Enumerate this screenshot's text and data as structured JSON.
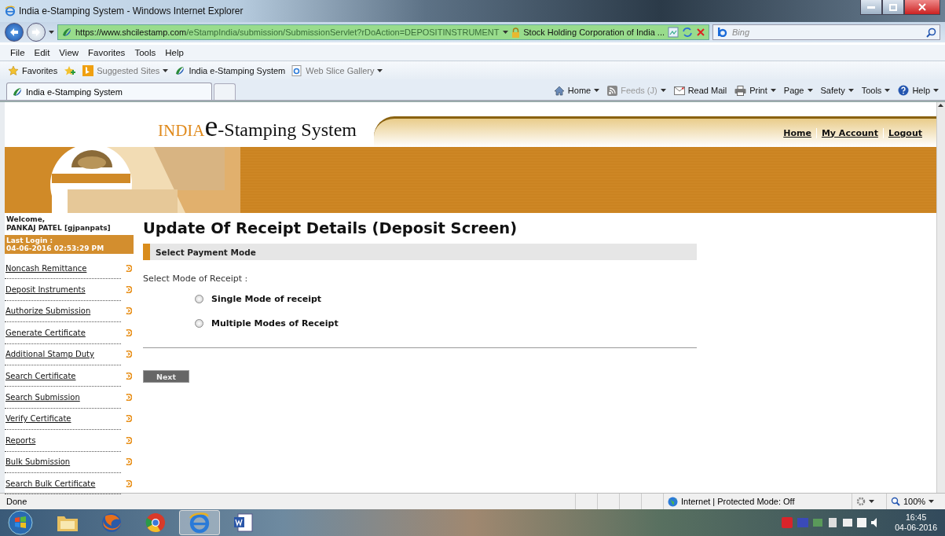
{
  "window": {
    "title": "India e-Stamping System - Windows Internet Explorer"
  },
  "address_bar": {
    "url_host": "https://www.shcilestamp.com",
    "url_path": "/eStampIndia/submission/SubmissionServlet?rDoAction=DEPOSITINSTRUMENT",
    "site_identity": "Stock Holding Corporation of India ...",
    "search_placeholder": "Bing"
  },
  "menu": [
    "File",
    "Edit",
    "View",
    "Favorites",
    "Tools",
    "Help"
  ],
  "favorites_bar": [
    {
      "label": "Favorites",
      "disabled": false,
      "dropdown": false
    },
    {
      "label": "Suggested Sites",
      "disabled": true,
      "dropdown": true
    },
    {
      "label": "India e-Stamping System",
      "disabled": false,
      "dropdown": false
    },
    {
      "label": "Web Slice Gallery",
      "disabled": true,
      "dropdown": true
    }
  ],
  "tabs": [
    {
      "label": "India e-Stamping System",
      "selected": true
    }
  ],
  "command_bar": [
    {
      "label": "Home",
      "disabled": false,
      "dropdown": true
    },
    {
      "label": "Feeds (J)",
      "disabled": true,
      "dropdown": true
    },
    {
      "label": "Read Mail",
      "disabled": false,
      "dropdown": false
    },
    {
      "label": "Print",
      "disabled": false,
      "dropdown": true
    },
    {
      "label": "Page",
      "disabled": false,
      "dropdown": true
    },
    {
      "label": "Safety",
      "disabled": false,
      "dropdown": true
    },
    {
      "label": "Tools",
      "disabled": false,
      "dropdown": true
    },
    {
      "label": "Help",
      "disabled": false,
      "dropdown": true
    }
  ],
  "page": {
    "logo": {
      "prefix": "INDIA",
      "initial": "e",
      "rest": "-Stamping System"
    },
    "header_links": [
      "Home",
      "My Account",
      "Logout"
    ],
    "sidebar": {
      "welcome": "Welcome,",
      "user": "PANKAJ  PATEL [gjpanpats]",
      "last_login_label": "Last Login :",
      "last_login": "04-06-2016 02:53:29 PM",
      "nav": [
        "Noncash Remittance",
        "Deposit Instruments",
        "Authorize Submission",
        "Generate Certificate",
        "Additional Stamp Duty",
        "Search Certificate",
        "Search Submission",
        "Verify Certificate",
        "Reports",
        "Bulk Submission",
        "Search Bulk Certificate"
      ]
    },
    "main": {
      "title": "Update Of Receipt Details (Deposit Screen)",
      "section": "Select Payment Mode",
      "prompt": "Select Mode of Receipt :",
      "options": [
        {
          "label": "Single Mode of receipt",
          "selected": false
        },
        {
          "label": "Multiple Modes of Receipt",
          "selected": false
        }
      ],
      "button": "Next"
    }
  },
  "status_bar": {
    "text": "Done",
    "zone": "Internet | Protected Mode: Off",
    "zoom": "100%"
  },
  "taskbar": {
    "apps": [
      {
        "kind": "folder",
        "selected": false
      },
      {
        "kind": "firefox",
        "selected": false
      },
      {
        "kind": "chrome",
        "selected": false
      },
      {
        "kind": "ie",
        "selected": true
      },
      {
        "kind": "word",
        "selected": false
      }
    ],
    "time": "16:45",
    "date": "04-06-2016"
  }
}
